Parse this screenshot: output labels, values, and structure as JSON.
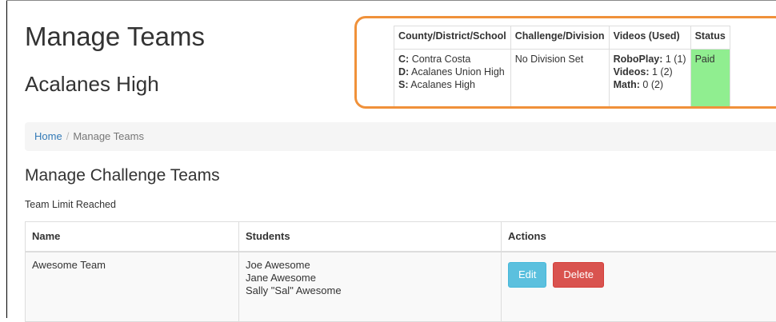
{
  "page": {
    "title": "Manage Teams",
    "school_name": "Acalanes High"
  },
  "info_table": {
    "headers": {
      "county": "County/District/School",
      "challenge": "Challenge/Division",
      "videos": "Videos (Used)",
      "status": "Status"
    },
    "county_label": "C:",
    "county_value": "Contra Costa",
    "district_label": "D:",
    "district_value": "Acalanes Union High",
    "school_label": "S:",
    "school_value": "Acalanes High",
    "division": "No Division Set",
    "roboplay_label": "RoboPlay:",
    "roboplay_value": "1 (1)",
    "videos_label": "Videos:",
    "videos_value": "1 (2)",
    "math_label": "Math:",
    "math_value": "0 (2)",
    "status": "Paid",
    "status_color": "#90EE90",
    "highlight_color": "#F0913A"
  },
  "breadcrumb": {
    "home": "Home",
    "separator": "/",
    "current": "Manage Teams"
  },
  "section": {
    "title": "Manage Challenge Teams",
    "note": "Team Limit Reached"
  },
  "teams_table": {
    "headers": {
      "name": "Name",
      "students": "Students",
      "actions": "Actions"
    },
    "rows": [
      {
        "name": "Awesome Team",
        "students": [
          "Joe Awesome",
          "Jane Awesome",
          "Sally \"Sal\" Awesome"
        ],
        "edit_label": "Edit",
        "delete_label": "Delete"
      }
    ]
  }
}
